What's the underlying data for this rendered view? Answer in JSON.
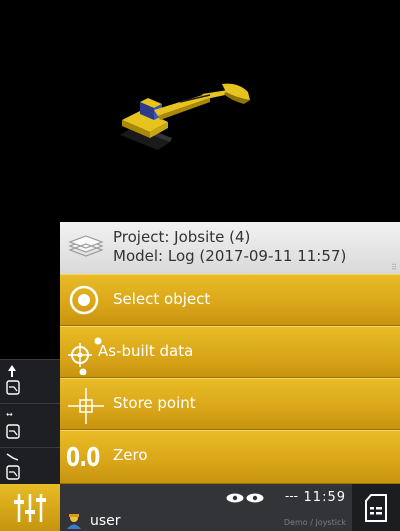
{
  "panel": {
    "project_line": "Project: Jobsite (4)",
    "model_line": "Model: Log (2017-09-11 11:57)",
    "items": [
      {
        "label": "Select object"
      },
      {
        "label": "As-built data"
      },
      {
        "label": "Store point"
      },
      {
        "label": "Zero",
        "value": "0.0"
      }
    ]
  },
  "status_bar": {
    "time": "11:59",
    "signal": "---",
    "user": "user",
    "mode": "Demo / Joystick"
  },
  "colors": {
    "accent": "#d9a519",
    "panel_header": "#e6e6e6",
    "toolbar": "#1e1f22"
  },
  "icons": {
    "side_toolbar": [
      "arrow-up-gauge-icon",
      "horizontal-arrows-gauge-icon",
      "curve-gauge-icon"
    ],
    "menu": [
      "layers-icon",
      "radio-target-icon",
      "gps-target-icon",
      "crosshair-icon"
    ],
    "bottom": [
      "sliders-icon",
      "eye-icon",
      "eye-icon",
      "user-icon",
      "document-icon"
    ]
  }
}
